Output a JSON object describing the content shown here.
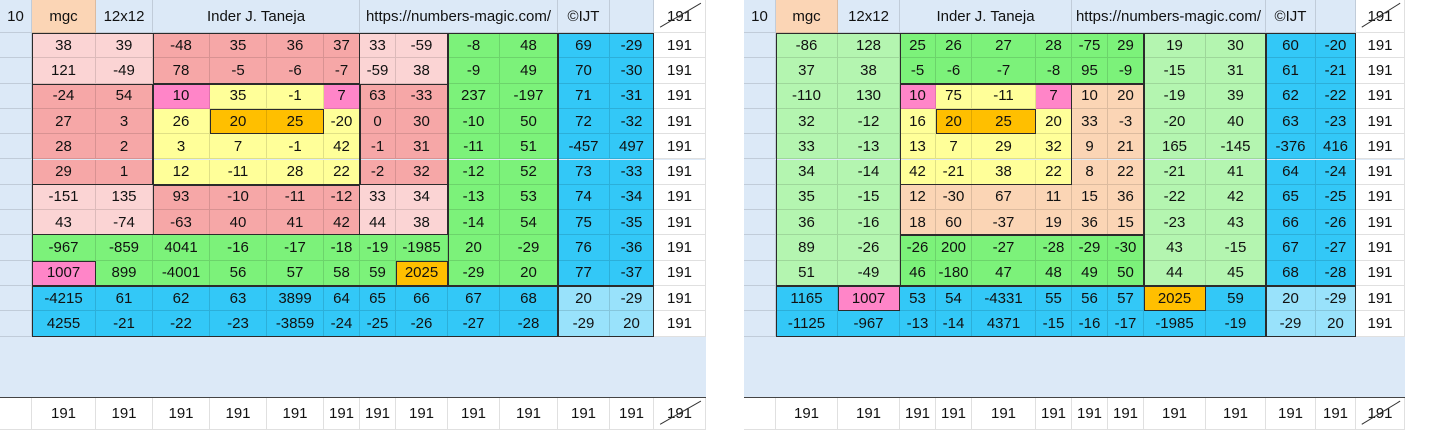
{
  "header": {
    "index": "10",
    "mgc": "mgc",
    "size": "12x12",
    "author": "Inder J. Taneja",
    "url": "https://numbers-magic.com/",
    "copyright": "©IJT",
    "corner_sum": "191"
  },
  "row_sum": "191",
  "colors": {
    "frame": "#dce9f7",
    "pink_light": "#fbd4d4",
    "pink": "#f6a7a7",
    "yellow": "#ffff99",
    "orange": "#ffbf00",
    "magenta": "#ff85c8",
    "green_light": "#b4f5b0",
    "green": "#7cf27a",
    "blue": "#33c8f7",
    "blue_light": "#99e2fb",
    "peach": "#fbd5b5",
    "white": "#ffffff"
  },
  "squares": [
    {
      "name": "left",
      "rows": [
        [
          "38",
          "39",
          "-48",
          "35",
          "36",
          "37",
          "33",
          "-59",
          "-8",
          "48",
          "69",
          "-29"
        ],
        [
          "121",
          "-49",
          "78",
          "-5",
          "-6",
          "-7",
          "-59",
          "38",
          "-9",
          "49",
          "70",
          "-30"
        ],
        [
          "-24",
          "54",
          "10",
          "35",
          "-1",
          "7",
          "63",
          "-33",
          "237",
          "-197",
          "71",
          "-31"
        ],
        [
          "27",
          "3",
          "26",
          "20",
          "25",
          "-20",
          "0",
          "30",
          "-10",
          "50",
          "72",
          "-32"
        ],
        [
          "28",
          "2",
          "3",
          "7",
          "-1",
          "42",
          "-1",
          "31",
          "-11",
          "51",
          "-457",
          "497"
        ],
        [
          "29",
          "1",
          "12",
          "-11",
          "28",
          "22",
          "-2",
          "32",
          "-12",
          "52",
          "73",
          "-33"
        ],
        [
          "-151",
          "135",
          "93",
          "-10",
          "-11",
          "-12",
          "33",
          "34",
          "-13",
          "53",
          "74",
          "-34"
        ],
        [
          "43",
          "-74",
          "-63",
          "40",
          "41",
          "42",
          "44",
          "38",
          "-14",
          "54",
          "75",
          "-35"
        ],
        [
          "-967",
          "-859",
          "4041",
          "-16",
          "-17",
          "-18",
          "-19",
          "-1985",
          "20",
          "-29",
          "76",
          "-36"
        ],
        [
          "1007",
          "899",
          "-4001",
          "56",
          "57",
          "58",
          "59",
          "2025",
          "-29",
          "20",
          "77",
          "-37"
        ],
        [
          "-4215",
          "61",
          "62",
          "63",
          "3899",
          "64",
          "65",
          "66",
          "67",
          "68",
          "20",
          "-29"
        ],
        [
          "4255",
          "-21",
          "-22",
          "-23",
          "-3859",
          "-24",
          "-25",
          "-26",
          "-27",
          "-28",
          "-29",
          "20"
        ]
      ],
      "colors": [
        [
          "pink_light",
          "pink_light",
          "pink",
          "pink",
          "pink",
          "pink",
          "pink_light",
          "pink_light",
          "green",
          "green",
          "blue",
          "blue"
        ],
        [
          "pink_light",
          "pink_light",
          "pink",
          "pink",
          "pink",
          "pink",
          "pink_light",
          "pink_light",
          "green",
          "green",
          "blue",
          "blue"
        ],
        [
          "pink",
          "pink",
          "magenta",
          "yellow",
          "yellow",
          "magenta",
          "pink",
          "pink",
          "green",
          "green",
          "blue",
          "blue"
        ],
        [
          "pink",
          "pink",
          "yellow",
          "orange",
          "orange",
          "yellow",
          "pink",
          "pink",
          "green",
          "green",
          "blue",
          "blue"
        ],
        [
          "pink",
          "pink",
          "yellow",
          "yellow",
          "yellow",
          "yellow",
          "pink",
          "pink",
          "green",
          "green",
          "blue",
          "blue"
        ],
        [
          "pink",
          "pink",
          "yellow",
          "yellow",
          "yellow",
          "yellow",
          "pink",
          "pink",
          "green",
          "green",
          "blue",
          "blue"
        ],
        [
          "pink_light",
          "pink_light",
          "pink",
          "pink",
          "pink",
          "pink",
          "pink_light",
          "pink_light",
          "green",
          "green",
          "blue",
          "blue"
        ],
        [
          "pink_light",
          "pink_light",
          "pink",
          "pink",
          "pink",
          "pink",
          "pink_light",
          "pink_light",
          "green",
          "green",
          "blue",
          "blue"
        ],
        [
          "green",
          "green",
          "green",
          "green",
          "green",
          "green",
          "green",
          "green",
          "green",
          "green",
          "blue",
          "blue"
        ],
        [
          "magenta",
          "green",
          "green",
          "green",
          "green",
          "green",
          "green",
          "orange",
          "green",
          "green",
          "blue",
          "blue"
        ],
        [
          "blue",
          "blue",
          "blue",
          "blue",
          "blue",
          "blue",
          "blue",
          "blue",
          "blue",
          "blue",
          "blue_light",
          "blue_light"
        ],
        [
          "blue",
          "blue",
          "blue",
          "blue",
          "blue",
          "blue",
          "blue",
          "blue",
          "blue",
          "blue",
          "blue_light",
          "blue_light"
        ]
      ]
    },
    {
      "name": "right",
      "rows": [
        [
          "-86",
          "128",
          "25",
          "26",
          "27",
          "28",
          "-75",
          "29",
          "19",
          "30",
          "60",
          "-20"
        ],
        [
          "37",
          "38",
          "-5",
          "-6",
          "-7",
          "-8",
          "95",
          "-9",
          "-15",
          "31",
          "61",
          "-21"
        ],
        [
          "-110",
          "130",
          "10",
          "75",
          "-11",
          "7",
          "10",
          "20",
          "-19",
          "39",
          "62",
          "-22"
        ],
        [
          "32",
          "-12",
          "16",
          "20",
          "25",
          "20",
          "33",
          "-3",
          "-20",
          "40",
          "63",
          "-23"
        ],
        [
          "33",
          "-13",
          "13",
          "7",
          "29",
          "32",
          "9",
          "21",
          "165",
          "-145",
          "-376",
          "416"
        ],
        [
          "34",
          "-14",
          "42",
          "-21",
          "38",
          "22",
          "8",
          "22",
          "-21",
          "41",
          "64",
          "-24"
        ],
        [
          "35",
          "-15",
          "12",
          "-30",
          "67",
          "11",
          "15",
          "36",
          "-22",
          "42",
          "65",
          "-25"
        ],
        [
          "36",
          "-16",
          "18",
          "60",
          "-37",
          "19",
          "36",
          "15",
          "-23",
          "43",
          "66",
          "-26"
        ],
        [
          "89",
          "-26",
          "-26",
          "200",
          "-27",
          "-28",
          "-29",
          "-30",
          "43",
          "-15",
          "67",
          "-27"
        ],
        [
          "51",
          "-49",
          "46",
          "-180",
          "47",
          "48",
          "49",
          "50",
          "44",
          "45",
          "68",
          "-28"
        ],
        [
          "1165",
          "1007",
          "53",
          "54",
          "-4331",
          "55",
          "56",
          "57",
          "2025",
          "59",
          "20",
          "-29"
        ],
        [
          "-1125",
          "-967",
          "-13",
          "-14",
          "4371",
          "-15",
          "-16",
          "-17",
          "-1985",
          "-19",
          "-29",
          "20"
        ]
      ],
      "colors": [
        [
          "green_light",
          "green_light",
          "green",
          "green",
          "green",
          "green",
          "green",
          "green",
          "green_light",
          "green_light",
          "blue",
          "blue"
        ],
        [
          "green_light",
          "green_light",
          "green",
          "green",
          "green",
          "green",
          "green",
          "green",
          "green_light",
          "green_light",
          "blue",
          "blue"
        ],
        [
          "green_light",
          "green_light",
          "magenta",
          "yellow",
          "yellow",
          "magenta",
          "peach",
          "peach",
          "green_light",
          "green_light",
          "blue",
          "blue"
        ],
        [
          "green_light",
          "green_light",
          "yellow",
          "orange",
          "orange",
          "yellow",
          "peach",
          "peach",
          "green_light",
          "green_light",
          "blue",
          "blue"
        ],
        [
          "green_light",
          "green_light",
          "yellow",
          "yellow",
          "yellow",
          "yellow",
          "peach",
          "peach",
          "green_light",
          "green_light",
          "blue",
          "blue"
        ],
        [
          "green_light",
          "green_light",
          "yellow",
          "yellow",
          "yellow",
          "yellow",
          "peach",
          "peach",
          "green_light",
          "green_light",
          "blue",
          "blue"
        ],
        [
          "green_light",
          "green_light",
          "peach",
          "peach",
          "peach",
          "peach",
          "peach",
          "peach",
          "green_light",
          "green_light",
          "blue",
          "blue"
        ],
        [
          "green_light",
          "green_light",
          "peach",
          "peach",
          "peach",
          "peach",
          "peach",
          "peach",
          "green_light",
          "green_light",
          "blue",
          "blue"
        ],
        [
          "green_light",
          "green_light",
          "green",
          "green",
          "green",
          "green",
          "green",
          "green",
          "green_light",
          "green_light",
          "blue",
          "blue"
        ],
        [
          "green_light",
          "green_light",
          "green",
          "green",
          "green",
          "green",
          "green",
          "green",
          "green_light",
          "green_light",
          "blue",
          "blue"
        ],
        [
          "blue",
          "magenta",
          "blue",
          "blue",
          "blue",
          "blue",
          "blue",
          "blue",
          "orange",
          "blue",
          "blue_light",
          "blue_light"
        ],
        [
          "blue",
          "blue",
          "blue",
          "blue",
          "blue",
          "blue",
          "blue",
          "blue",
          "blue",
          "blue",
          "blue_light",
          "blue_light"
        ]
      ]
    }
  ]
}
